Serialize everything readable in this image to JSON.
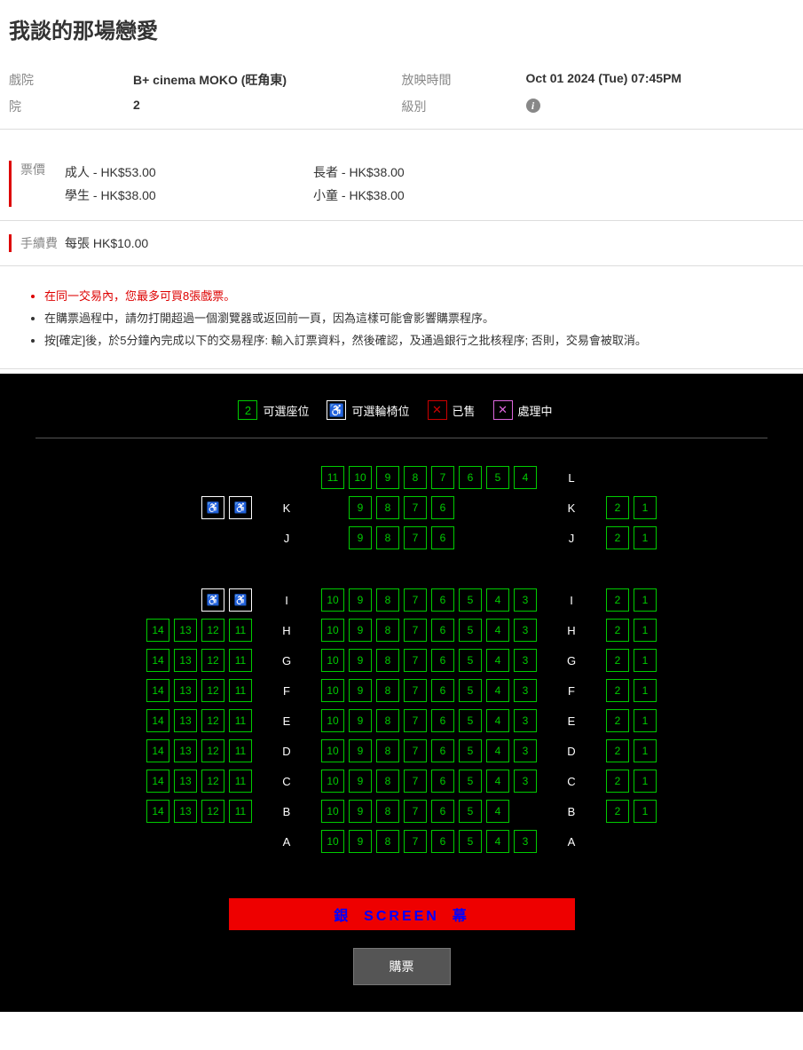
{
  "movie": {
    "title": "我談的那場戀愛"
  },
  "info": {
    "cinema_label": "戲院",
    "cinema": "B+ cinema MOKO (旺角東)",
    "showtime_label": "放映時間",
    "showtime": "Oct 01 2024 (Tue) 07:45PM",
    "house_label": "院",
    "house": "2",
    "rating_label": "級別"
  },
  "pricing": {
    "label": "票價",
    "adult": "成人 - HK$53.00",
    "student": "學生 - HK$38.00",
    "senior": "長者 - HK$38.00",
    "child": "小童 - HK$38.00"
  },
  "fee": {
    "label": "手續費",
    "value": "每張 HK$10.00"
  },
  "notes": [
    "在同一交易內，您最多可買8張戲票。",
    "在購票過程中，請勿打開超過一個瀏覽器或返回前一頁，因為這樣可能會影響購票程序。",
    "按[確定]後，於5分鐘內完成以下的交易程序: 輸入訂票資料，然後確認，及通過銀行之批核程序; 否則，交易會被取消。"
  ],
  "legend": {
    "available_num": "2",
    "available": "可選座位",
    "wheelchair": "可選輪椅位",
    "sold": "已售",
    "processing": "處理中"
  },
  "screen": {
    "left": "銀",
    "center": "SCREEN",
    "right": "幕"
  },
  "buttons": {
    "buy": "購票"
  },
  "seatmap": [
    {
      "row": "L",
      "left14": [],
      "wheel": false,
      "leftLabel": false,
      "center": [
        11,
        10,
        9,
        8,
        7,
        6,
        5,
        4
      ],
      "centerPad": 0,
      "right": [],
      "rightLabel": true
    },
    {
      "row": "K",
      "left14": [],
      "wheel": true,
      "leftLabel": true,
      "center": [
        9,
        8,
        7,
        6
      ],
      "centerPad": 1,
      "right": [
        2,
        1
      ],
      "rightLabel": true
    },
    {
      "row": "J",
      "left14": [],
      "wheel": false,
      "leftLabel": true,
      "center": [
        9,
        8,
        7,
        6
      ],
      "centerPad": 1,
      "right": [
        2,
        1
      ],
      "rightLabel": true
    },
    {
      "gap": true
    },
    {
      "row": "I",
      "left14": [],
      "wheel": true,
      "leftLabel": true,
      "center": [
        10,
        9,
        8,
        7,
        6,
        5,
        4,
        3
      ],
      "centerPad": 0,
      "right": [
        2,
        1
      ],
      "rightLabel": true
    },
    {
      "row": "H",
      "left14": [
        14,
        13,
        12,
        11
      ],
      "wheel": false,
      "leftLabel": true,
      "center": [
        10,
        9,
        8,
        7,
        6,
        5,
        4,
        3
      ],
      "centerPad": 0,
      "right": [
        2,
        1
      ],
      "rightLabel": true
    },
    {
      "row": "G",
      "left14": [
        14,
        13,
        12,
        11
      ],
      "wheel": false,
      "leftLabel": true,
      "center": [
        10,
        9,
        8,
        7,
        6,
        5,
        4,
        3
      ],
      "centerPad": 0,
      "right": [
        2,
        1
      ],
      "rightLabel": true
    },
    {
      "row": "F",
      "left14": [
        14,
        13,
        12,
        11
      ],
      "wheel": false,
      "leftLabel": true,
      "center": [
        10,
        9,
        8,
        7,
        6,
        5,
        4,
        3
      ],
      "centerPad": 0,
      "right": [
        2,
        1
      ],
      "rightLabel": true
    },
    {
      "row": "E",
      "left14": [
        14,
        13,
        12,
        11
      ],
      "wheel": false,
      "leftLabel": true,
      "center": [
        10,
        9,
        8,
        7,
        6,
        5,
        4,
        3
      ],
      "centerPad": 0,
      "right": [
        2,
        1
      ],
      "rightLabel": true
    },
    {
      "row": "D",
      "left14": [
        14,
        13,
        12,
        11
      ],
      "wheel": false,
      "leftLabel": true,
      "center": [
        10,
        9,
        8,
        7,
        6,
        5,
        4,
        3
      ],
      "centerPad": 0,
      "right": [
        2,
        1
      ],
      "rightLabel": true
    },
    {
      "row": "C",
      "left14": [
        14,
        13,
        12,
        11
      ],
      "wheel": false,
      "leftLabel": true,
      "center": [
        10,
        9,
        8,
        7,
        6,
        5,
        4,
        3
      ],
      "centerPad": 0,
      "right": [
        2,
        1
      ],
      "rightLabel": true
    },
    {
      "row": "B",
      "left14": [
        14,
        13,
        12,
        11
      ],
      "wheel": false,
      "leftLabel": true,
      "center": [
        10,
        9,
        8,
        7,
        6,
        5,
        4
      ],
      "centerPad": 0,
      "right": [
        2,
        1
      ],
      "rightLabel": true
    },
    {
      "row": "A",
      "left14": [],
      "wheel": false,
      "leftLabel": true,
      "center": [
        10,
        9,
        8,
        7,
        6,
        5,
        4,
        3
      ],
      "centerPad": 0,
      "right": [],
      "rightLabel": true
    }
  ]
}
